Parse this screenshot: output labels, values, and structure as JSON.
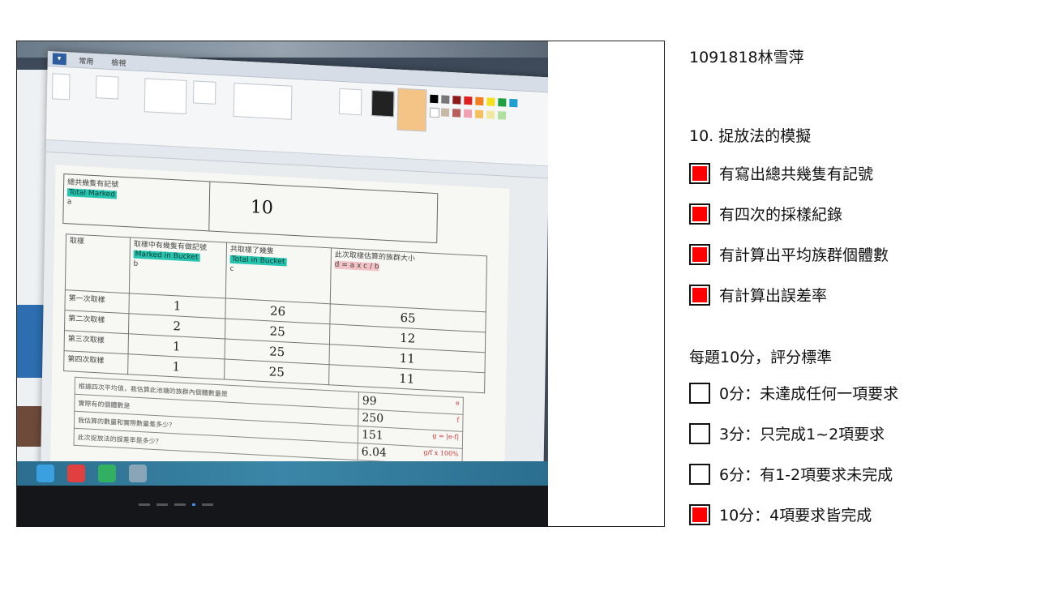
{
  "student": {
    "id_name": "1091818林雪萍"
  },
  "question": {
    "title": "10. 捉放法的模擬",
    "criteria": [
      {
        "label": "有寫出總共幾隻有記號",
        "checked": true
      },
      {
        "label": "有四次的採樣紀錄",
        "checked": true
      },
      {
        "label": "有計算出平均族群個體數",
        "checked": true
      },
      {
        "label": "有計算出誤差率",
        "checked": true
      }
    ]
  },
  "rubric": {
    "title": "每題10分，評分標準",
    "levels": [
      {
        "label": "0分：未達成任何一項要求",
        "checked": false
      },
      {
        "label": "3分：只完成1~2項要求",
        "checked": false
      },
      {
        "label": "6分：有1-2項要求未完成",
        "checked": false
      },
      {
        "label": "10分：4項要求皆完成",
        "checked": true
      }
    ]
  },
  "colors": {
    "check_mark": "#ff0000"
  },
  "photo": {
    "ribbon_tabs": [
      "常用",
      "檢視"
    ],
    "total_marked_box": {
      "label": "總共幾隻有記號",
      "tag": "Total Marked",
      "var": "a",
      "value": "10"
    },
    "table_headers": [
      "取樣",
      "取樣中有幾隻有做記號",
      "共取樣了幾隻",
      "此次取樣估算的族群大小"
    ],
    "header_tags": [
      "",
      "Marked in Bucket",
      "Total in Bucket",
      "d = a x c / b"
    ],
    "header_vars": [
      "",
      "b",
      "c",
      ""
    ],
    "rows": [
      {
        "label": "第一次取樣",
        "b": "1",
        "c": "26",
        "d": "65"
      },
      {
        "label": "第二次取樣",
        "b": "2",
        "c": "25",
        "d": "12"
      },
      {
        "label": "第三次取樣",
        "b": "1",
        "c": "25",
        "d": "11"
      },
      {
        "label": "第四次取樣",
        "b": "1",
        "c": "25",
        "d": "11"
      }
    ],
    "summary": [
      {
        "label": "根據四次平均值，我估算此池塘的族群內個體數量是",
        "value": "99",
        "tag": "e"
      },
      {
        "label": "實際有的個體數是",
        "value": "250",
        "tag": "f"
      },
      {
        "label": "我估算的數量和實際數量差多少？",
        "value": "151",
        "tag": "g = |e-f|"
      },
      {
        "label": "此次捉放法的誤差率是多少？",
        "value": "6.04",
        "tag": "g/f x 100%"
      }
    ]
  }
}
